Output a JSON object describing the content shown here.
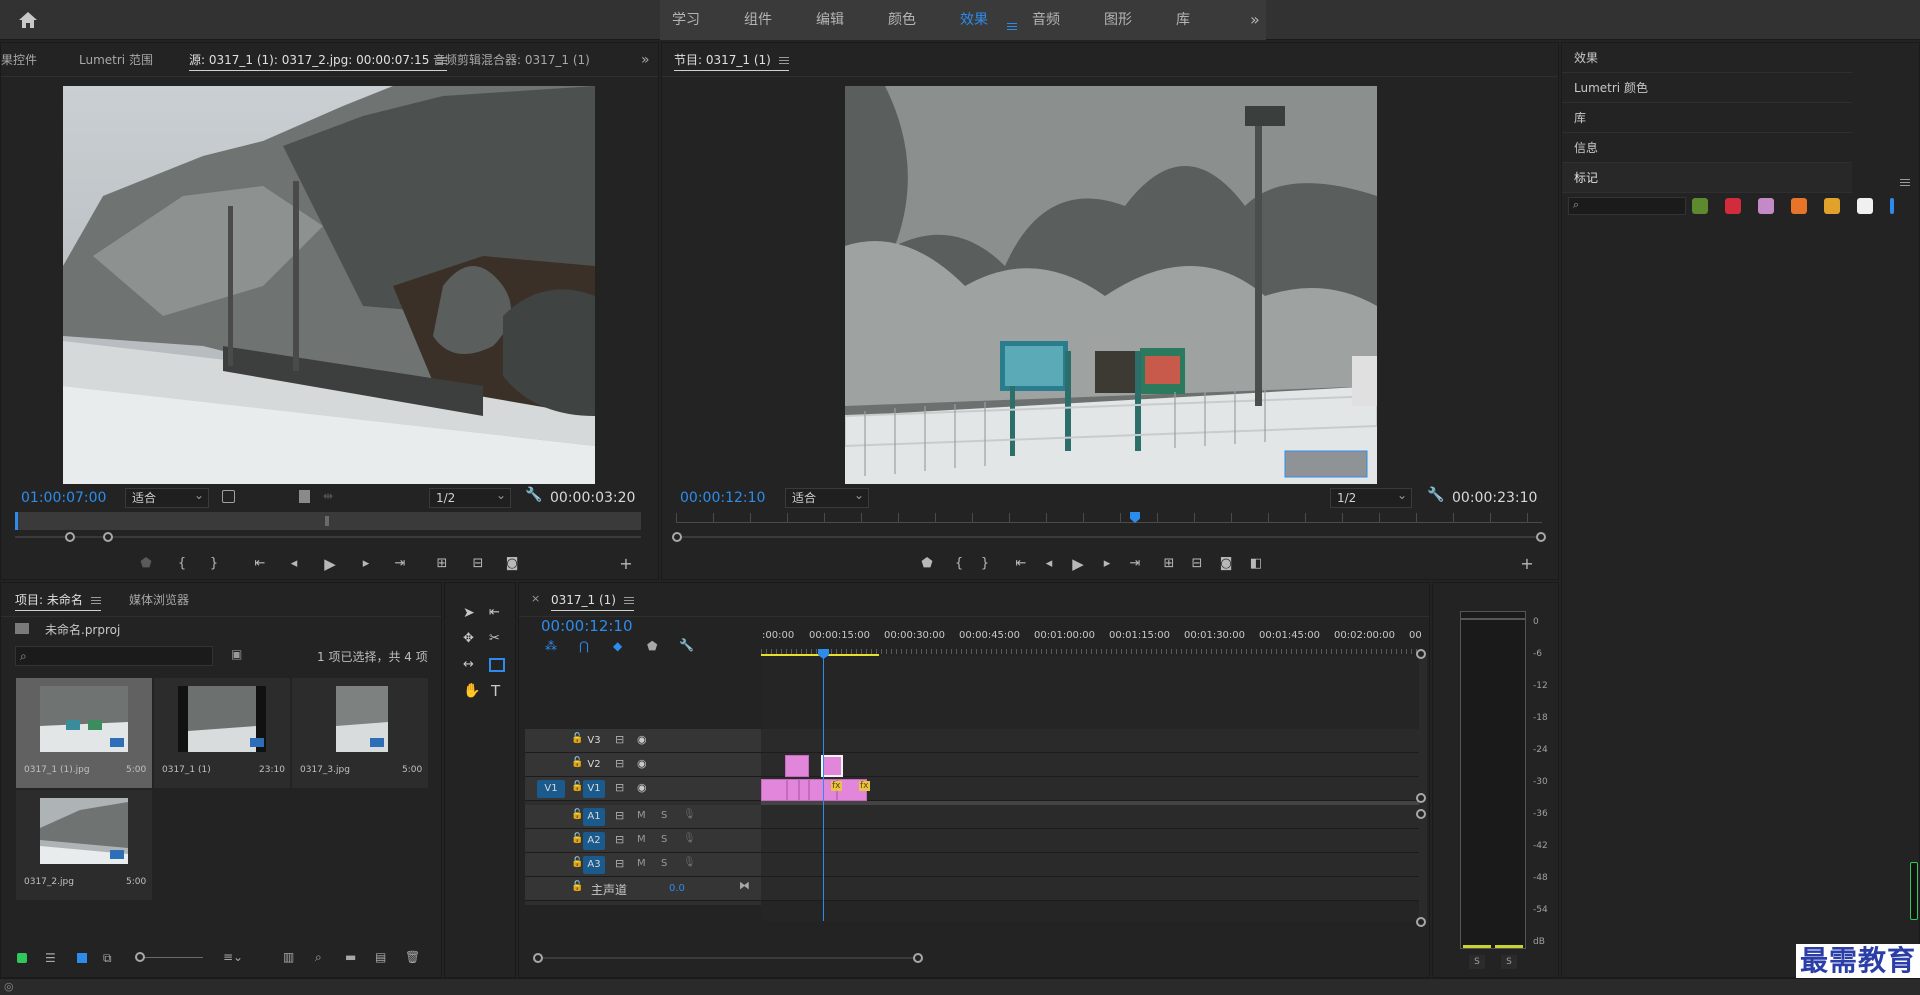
{
  "topbar": {
    "home_icon": "home-icon",
    "workspaces": [
      "学习",
      "组件",
      "编辑",
      "颜色",
      "效果",
      "音频",
      "图形",
      "库"
    ],
    "active_workspace": "效果",
    "more": "»"
  },
  "source_panel": {
    "tabs": [
      "果控件",
      "Lumetri 范围",
      "源: 0317_1 (1): 0317_2.jpg: 00:00:07:15",
      "音频剪辑混合器: 0317_1 (1)"
    ],
    "more": "»",
    "timecode_current": "01:00:07:00",
    "fit": "适合",
    "resolution": "1/2",
    "timecode_duration": "00:00:03:20"
  },
  "program_panel": {
    "title": "节目: 0317_1 (1)",
    "timecode_current": "00:00:12:10",
    "fit": "适合",
    "resolution": "1/2",
    "timecode_duration": "00:00:23:10"
  },
  "right_panel": {
    "items": [
      "效果",
      "Lumetri 颜色",
      "库",
      "信息",
      "标记"
    ],
    "swatch_colors": [
      "#5d8a2e",
      "#d22b3b",
      "#c48ac7",
      "#e8742a",
      "#e0a22b",
      "#f0f0f0",
      "#2d8ceb"
    ]
  },
  "project_panel": {
    "tabs": [
      "项目: 未命名",
      "媒体浏览器"
    ],
    "project_file": "未命名.prproj",
    "selection_info": "1 项已选择，共 4 项",
    "items": [
      {
        "name": "0317_1 (1).jpg",
        "duration": "5:00"
      },
      {
        "name": "0317_1 (1)",
        "duration": "23:10"
      },
      {
        "name": "0317_3.jpg",
        "duration": "5:00"
      },
      {
        "name": "0317_2.jpg",
        "duration": "5:00"
      }
    ]
  },
  "timeline": {
    "tab": "0317_1 (1)",
    "close": "×",
    "timecode": "00:00:12:10",
    "ruler_labels": [
      ":00:00",
      "00:00:15:00",
      "00:00:30:00",
      "00:00:45:00",
      "00:01:00:00",
      "00:01:15:00",
      "00:01:30:00",
      "00:01:45:00",
      "00:02:00:00",
      "00"
    ],
    "video_tracks": [
      "V3",
      "V2",
      "V1"
    ],
    "source_patch": "V1",
    "audio_tracks": [
      "A1",
      "A2",
      "A3"
    ],
    "mute": "M",
    "solo": "S",
    "master_label": "主声道",
    "master_value": "0.0",
    "fx_label": "fx"
  },
  "audio_meter": {
    "labels": [
      "0",
      "-6",
      "-12",
      "-18",
      "-24",
      "-30",
      "-36",
      "-42",
      "-48",
      "-54",
      "dB"
    ],
    "solo_buttons": [
      "S",
      "S"
    ]
  },
  "watermark": "最需教育"
}
